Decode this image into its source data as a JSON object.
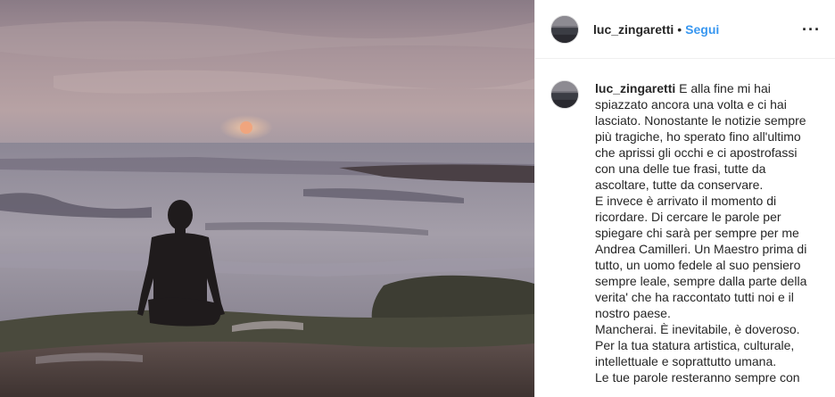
{
  "header": {
    "username": "luc_zingaretti",
    "separator": "•",
    "follow_label": "Segui",
    "more_icon": "more-options-icon",
    "more_glyph": "···"
  },
  "caption": {
    "username": "luc_zingaretti",
    "paragraph1": "E alla fine mi hai spiazzato ancora una volta e ci hai lasciato. Nonostante le notizie sempre più tragiche, ho sperato fino all'ultimo che aprissi gli occhi e ci apostrofassi con una delle tue frasi, tutte da ascoltare, tutte da conservare.",
    "paragraph2": "E invece è arrivato il momento di ricordare. Di cercare le parole per spiegare chi sarà per sempre per me Andrea Camilleri. Un Maestro prima di tutto, un uomo fedele al suo pensiero sempre leale, sempre dalla parte della verita' che ha raccontato tutti noi e il nostro paese.",
    "paragraph3": "Mancherai. È inevitabile, è doveroso. Per la tua statura artistica, culturale, intellettuale e soprattutto umana.",
    "paragraph4": "Le tue parole resteranno sempre con"
  },
  "colors": {
    "follow": "#3897f0",
    "text": "#262626",
    "border": "#efefef"
  }
}
